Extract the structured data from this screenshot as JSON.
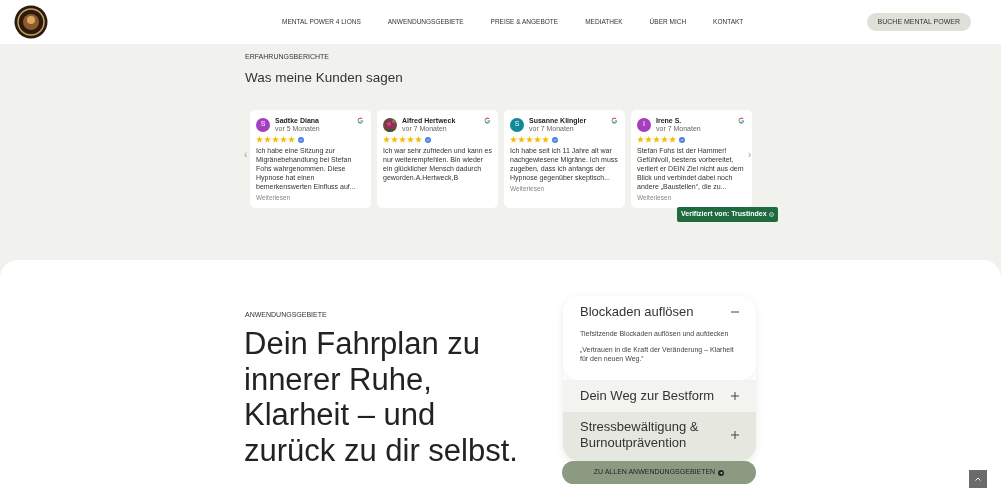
{
  "nav": {
    "links": [
      "MENTAL POWER 4 LIONS",
      "ANWENDUNGSGEBIETE",
      "PREISE & ANGEBOTE",
      "MEDIATHEK",
      "ÜBER MICH",
      "KONTAKT"
    ],
    "cta": "BUCHE MENTAL POWER"
  },
  "reviews": {
    "eyebrow": "ERFAHRUNGSBERICHTE",
    "title": "Was meine Kunden sagen",
    "prev": "‹",
    "next": "›",
    "items": [
      {
        "name": "Sadtke Diana",
        "time": "vor 5 Monaten",
        "avatar": {
          "kind": "letter",
          "letter": "S",
          "color": "#a53fc0"
        },
        "stars": 5,
        "text": "Ich habe eine Sitzung zur Migränebehandlung bei Stefan Fohs wahrgenommen. Diese Hypnose hat einen bemerkenswerten Einfluss auf...",
        "more": "Weiterlesen"
      },
      {
        "name": "Alfred Hertweck",
        "time": "vor 7 Monaten",
        "stars": 5,
        "text": "Ich war sehr zufrieden und kann es nur weiterempfehlen. Bin wieder ein glücklicher Mensch dadurch geworden.A.Hertweck,B"
      },
      {
        "name": "Susanne Klingler",
        "time": "vor 7 Monaten",
        "avatar": {
          "kind": "letter",
          "letter": "S",
          "color": "#0f8a96"
        },
        "stars": 5,
        "text": "Ich habe seit ich 11 Jahre alt war nachgewiesene Migräne. Ich muss zugeben, dass ich anfangs der Hypnose gegenüber skeptisch...",
        "more": "Weiterlesen"
      },
      {
        "name": "Irene S.",
        "time": "vor 7 Monaten",
        "avatar": {
          "kind": "letter",
          "letter": "I",
          "color": "#a63fbd"
        },
        "stars": 5,
        "text": "Stefan Fohs ist der Hammer! Gefühlvoll, bestens vorbereitet, verliert er DEIN Ziel nicht aus dem Blick und verbindet dabei noch andere „Baustellen“, die zu...",
        "more": "Weiterlesen"
      }
    ],
    "badge": "Verifiziert von: Trustindex"
  },
  "areas": {
    "eyebrow": "ANWENDUNGSGEBIETE",
    "heading": "Dein Fahrplan zu\ninnerer Ruhe,\nKlarheit – und\nzurück zu dir selbst.",
    "accordion": [
      {
        "title": "Blockaden auflösen",
        "expanded": true,
        "body": [
          "Tiefsitzende Blockaden auflösen und aufdecken",
          "„Vertrauen in die Kraft der Veränderung – Klarheit für den neuen Weg.“"
        ]
      },
      {
        "title": "Dein Weg zur Bestform",
        "expanded": false
      },
      {
        "title": "Stressbewältigung & Burnoutprävention",
        "expanded": false
      }
    ],
    "button": "ZU ALLEN ANWENDUNGSGEBIETEN"
  }
}
